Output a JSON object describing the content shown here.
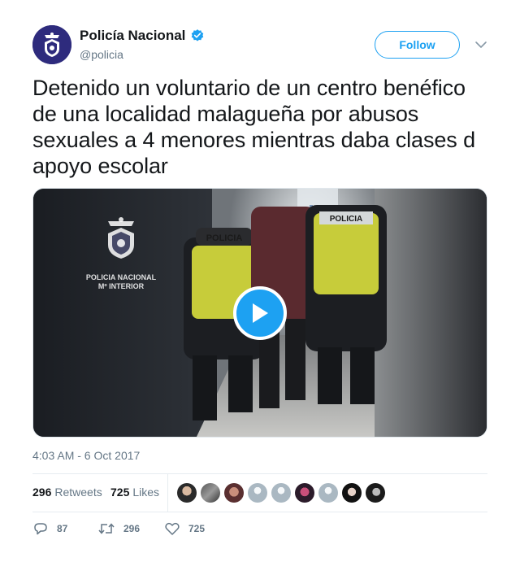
{
  "account": {
    "display_name": "Policía Nacional",
    "handle": "@policia",
    "verified_icon": "verified-badge-icon",
    "follow_label": "Follow"
  },
  "tweet": {
    "text": "Detenido un voluntario de un centro benéfico de una localidad malagueña por abusos sexuales a 4 menores mientras daba clases d apoyo escolar",
    "timestamp": "4:03 AM - 6 Oct 2017"
  },
  "media": {
    "type": "video",
    "logo_line1": "POLICIA NACIONAL",
    "logo_line2": "Mº INTERIOR",
    "vest_left": "POLICIA",
    "vest_right": "POLICIA",
    "play_icon": "play-icon"
  },
  "stats": {
    "retweets_count": "296",
    "retweets_label": "Retweets",
    "likes_count": "725",
    "likes_label": "Likes",
    "liker_avatars": 9
  },
  "actions": {
    "reply_count": "87",
    "retweet_count": "296",
    "like_count": "725"
  },
  "colors": {
    "accent": "#1da1f2",
    "text": "#14171a",
    "secondary": "#657786",
    "border": "#e6ecf0"
  }
}
